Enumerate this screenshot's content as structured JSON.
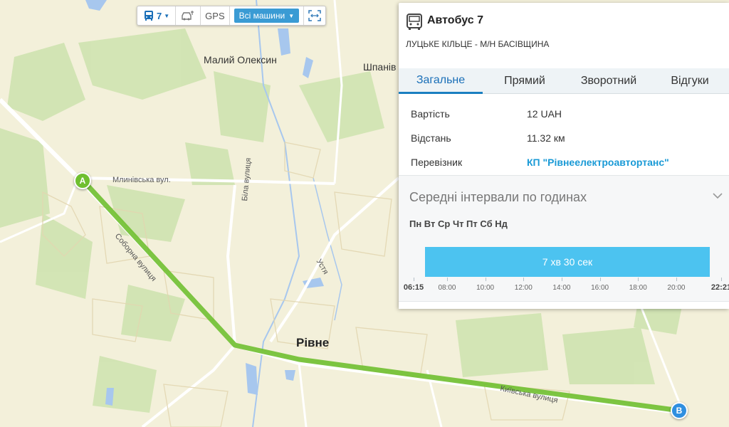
{
  "colors": {
    "route": "#6fbf2f",
    "accent": "#1a9ad6",
    "interval_bar": "#4cc3f0",
    "marker_a": "#6fbf2f",
    "marker_b": "#2f8fe0"
  },
  "map": {
    "labels": {
      "maliy_oleksyn": "Малий Олексин",
      "shpaniv": "Шпанів",
      "rivne": "Рівне",
      "mlynivska": "Млинівська вул.",
      "soborna": "Соборна вулиця",
      "bila": "Біла вулиця",
      "ustia": "Устя",
      "kyivska": "Київська вулиця"
    },
    "markers": {
      "a": "A",
      "b": "B"
    }
  },
  "toolbar": {
    "route_number": "7",
    "gps_label": "GPS",
    "all_cars_label": "Всі машини",
    "icons": [
      "bus-icon",
      "caret-down-icon",
      "cars-gps-icon",
      "fit-bounds-icon"
    ]
  },
  "panel": {
    "title": "Автобус 7",
    "subtitle": "ЛУЦЬКЕ КІЛЬЦЕ - М/Н БАСІВЩИНА",
    "tabs": [
      {
        "label": "Загальне",
        "active": true
      },
      {
        "label": "Прямий",
        "active": false
      },
      {
        "label": "Зворотний",
        "active": false
      },
      {
        "label": "Відгуки",
        "active": false
      }
    ],
    "info": [
      {
        "label": "Вартість",
        "value": "12 UAH"
      },
      {
        "label": "Відстань",
        "value": "11.32 км"
      },
      {
        "label": "Перевізник",
        "value": "КП \"Рівнеелектроавтортанс\""
      }
    ],
    "intervals": {
      "title": "Середні інтервали по годинах",
      "days": "Пн Вт Ср Чт Пт Сб Нд",
      "interval_value": "7 хв 30 сек",
      "start_time": "06:15",
      "end_time": "22:21",
      "ticks": [
        "08:00",
        "10:00",
        "12:00",
        "14:00",
        "16:00",
        "18:00",
        "20:00"
      ]
    }
  }
}
